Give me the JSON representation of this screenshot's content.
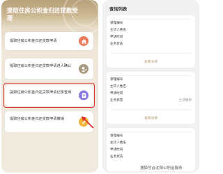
{
  "left_screen": {
    "title": "提取住房公积金归还贷款受理",
    "menu_items": [
      {
        "label": "提取住房公积金归还贷款申请",
        "icon": "house-icon",
        "icon_color": "#e8795a"
      },
      {
        "label": "提取住房公积金归还贷款申请进人确认",
        "icon": "person-check-icon",
        "icon_color": "#a99983"
      },
      {
        "label": "提取住房公积金归还贷款申请记录查询",
        "icon": "document-icon",
        "icon_color": "#8c7be0"
      },
      {
        "label": "提取住房公积金归还贷款申请撤销",
        "icon": "pencil-icon",
        "icon_color": "#f1b73c"
      }
    ],
    "highlight_color": "#d9302c"
  },
  "right_screen": {
    "title": "查询列表",
    "records": [
      {
        "fields": [
          {
            "label": "受理编号",
            "value": ""
          },
          {
            "label": "主贷人姓名",
            "value": ""
          },
          {
            "label": "申请时间",
            "value": ""
          },
          {
            "label": "业务状态",
            "value": ""
          }
        ],
        "detail_link": "查看详情"
      },
      {
        "fields": [
          {
            "label": "受理编号",
            "value": ""
          },
          {
            "label": "主贷人姓名",
            "value": ""
          },
          {
            "label": "申请时间",
            "value": ""
          },
          {
            "label": "业务状态",
            "value": "主贷撤销"
          }
        ],
        "detail_link": "查看详情"
      },
      {
        "fields": [
          {
            "label": "受理编号",
            "value": ""
          },
          {
            "label": "主贷人姓名",
            "value": ""
          },
          {
            "label": "申请时间",
            "value": ""
          },
          {
            "label": "业务状态",
            "value": ""
          }
        ],
        "detail_link": "查看详情"
      }
    ],
    "watermark": "搜狐号@沈阳公积金服务"
  }
}
